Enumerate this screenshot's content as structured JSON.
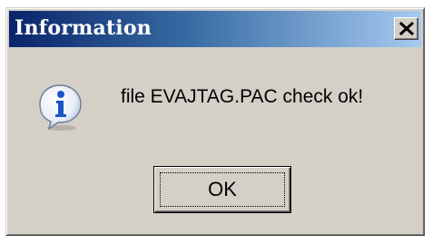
{
  "dialog": {
    "title": "Information",
    "message": "file EVAJTAG.PAC check ok!",
    "ok_label": "OK",
    "icon": "information-icon",
    "close_icon": "close-icon"
  },
  "colors": {
    "titlebar_start": "#0a246a",
    "titlebar_end": "#a6caf0",
    "window_face": "#d4d0c8",
    "icon_blue": "#1a56c8"
  }
}
